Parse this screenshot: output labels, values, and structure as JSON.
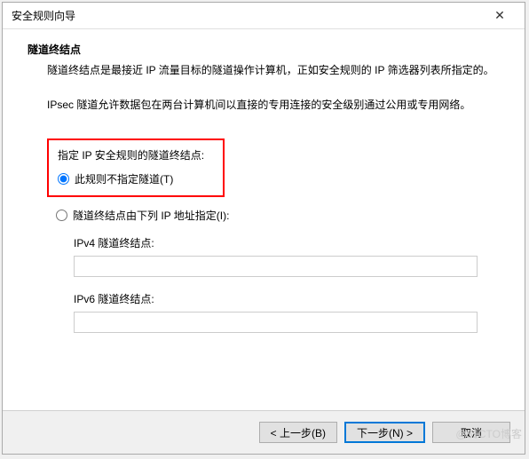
{
  "dialog": {
    "title": "安全规则向导",
    "close_symbol": "✕"
  },
  "section": {
    "heading": "隧道终结点",
    "description": "隧道终结点是最接近 IP 流量目标的隧道操作计算机，正如安全规则的 IP 筛选器列表所指定的。",
    "ipsec_note": "IPsec 隧道允许数据包在两台计算机间以直接的专用连接的安全级别通过公用或专用网络。"
  },
  "form": {
    "specify_label": "指定 IP 安全规则的隧道终结点:",
    "radio_no_tunnel": "此规则不指定隧道(T)",
    "radio_by_ip": "隧道终结点由下列 IP 地址指定(I):",
    "ipv4_label": "IPv4 隧道终结点:",
    "ipv4_value": "",
    "ipv6_label": "IPv6 隧道终结点:",
    "ipv6_value": "",
    "selected": "no_tunnel"
  },
  "buttons": {
    "back": "< 上一步(B)",
    "next": "下一步(N) >",
    "cancel": "取消"
  },
  "watermark": "@51CTO博客"
}
